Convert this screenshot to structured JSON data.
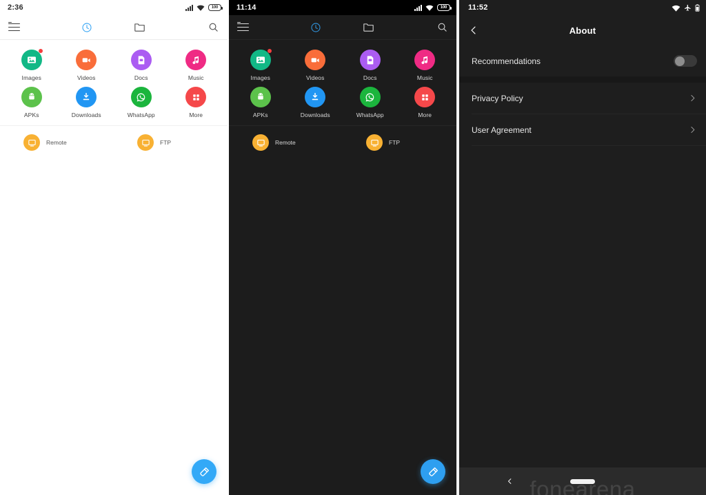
{
  "panels": {
    "light_file_manager": {
      "status": {
        "time": "2:36",
        "signal": "signal-bars-icon",
        "wifi": "wifi-icon",
        "battery_level": "100"
      },
      "toolbar": {
        "menu": "hamburger-menu-icon",
        "recent": "clock-icon",
        "folders": "folder-icon",
        "search": "search-icon"
      },
      "categories": [
        {
          "label": "Images",
          "color": "#12b886",
          "icon": "image-icon",
          "badge": true
        },
        {
          "label": "Videos",
          "color": "#f96d3a",
          "icon": "video-icon",
          "badge": false
        },
        {
          "label": "Docs",
          "color": "#ab5cf2",
          "icon": "document-icon",
          "badge": false
        },
        {
          "label": "Music",
          "color": "#ef2b84",
          "icon": "music-note-icon",
          "badge": false
        },
        {
          "label": "APKs",
          "color": "#5cc24b",
          "icon": "android-icon",
          "badge": false
        },
        {
          "label": "Downloads",
          "color": "#2196f3",
          "icon": "download-icon",
          "badge": false
        },
        {
          "label": "WhatsApp",
          "color": "#1bb53d",
          "icon": "whatsapp-icon",
          "badge": false
        },
        {
          "label": "More",
          "color": "#f5484a",
          "icon": "grid-icon",
          "badge": false
        }
      ],
      "services": [
        {
          "label": "Remote",
          "icon": "remote-screen-icon"
        },
        {
          "label": "FTP",
          "icon": "ftp-screen-icon"
        }
      ],
      "fab": {
        "icon": "cleaner-brush-icon",
        "color": "#33a9f7"
      }
    },
    "dark_file_manager": {
      "status": {
        "time": "11:14",
        "signal": "signal-bars-icon",
        "wifi": "wifi-icon",
        "battery_level": "100"
      },
      "toolbar": {
        "menu": "hamburger-menu-icon",
        "recent": "clock-icon",
        "folders": "folder-icon",
        "search": "search-icon"
      },
      "categories": [
        {
          "label": "Images",
          "color": "#12b886",
          "icon": "image-icon",
          "badge": true
        },
        {
          "label": "Videos",
          "color": "#f96d3a",
          "icon": "video-icon",
          "badge": false
        },
        {
          "label": "Docs",
          "color": "#ab5cf2",
          "icon": "document-icon",
          "badge": false
        },
        {
          "label": "Music",
          "color": "#ef2b84",
          "icon": "music-note-icon",
          "badge": false
        },
        {
          "label": "APKs",
          "color": "#5cc24b",
          "icon": "android-icon",
          "badge": false
        },
        {
          "label": "Downloads",
          "color": "#2196f3",
          "icon": "download-icon",
          "badge": false
        },
        {
          "label": "WhatsApp",
          "color": "#1bb53d",
          "icon": "whatsapp-icon",
          "badge": false
        },
        {
          "label": "More",
          "color": "#f5484a",
          "icon": "grid-icon",
          "badge": false
        }
      ],
      "services": [
        {
          "label": "Remote",
          "icon": "remote-screen-icon"
        },
        {
          "label": "FTP",
          "icon": "ftp-screen-icon"
        }
      ],
      "fab": {
        "icon": "cleaner-brush-icon",
        "color": "#2e9ff0"
      }
    },
    "about": {
      "status": {
        "time": "11:52",
        "wifi": "wifi-icon",
        "airplane": "airplane-mode-icon",
        "battery": "battery-icon"
      },
      "header": {
        "back": "back-chevron-icon",
        "title": "About"
      },
      "rows": [
        {
          "label": "Recommendations",
          "control": "toggle",
          "toggle_on": false
        },
        {
          "label": "Privacy Policy",
          "control": "chevron"
        },
        {
          "label": "User Agreement",
          "control": "chevron"
        }
      ],
      "navbar": {
        "back": "nav-back-icon",
        "home": "home-pill-indicator"
      },
      "watermark": "fonearena"
    }
  }
}
